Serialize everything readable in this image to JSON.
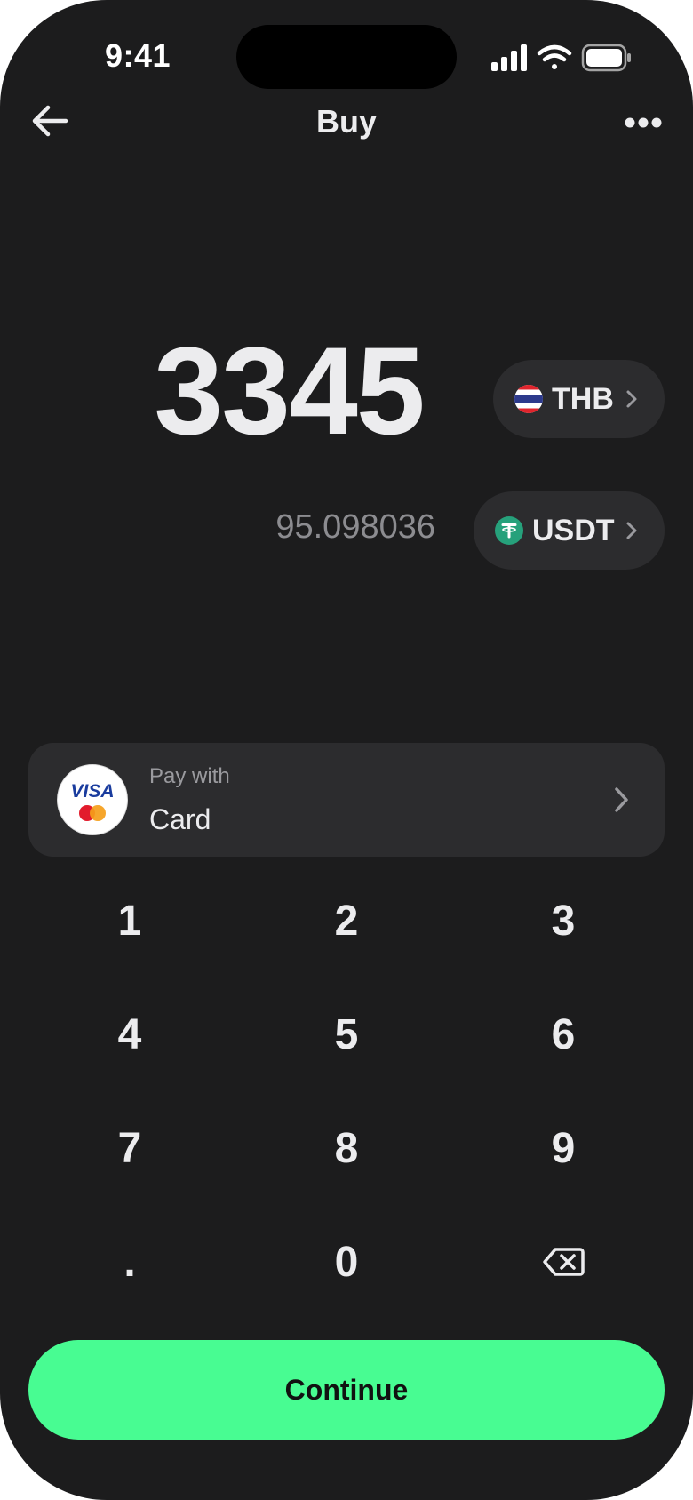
{
  "status_bar": {
    "time": "9:41"
  },
  "nav": {
    "title": "Buy"
  },
  "amount": {
    "value": "3345",
    "converted": "95.098036"
  },
  "currencies": {
    "fiat": {
      "code": "THB",
      "icon": "thailand-flag-icon"
    },
    "crypto": {
      "code": "USDT",
      "icon": "tether-icon",
      "icon_color": "#26a17b"
    }
  },
  "payment": {
    "caption": "Pay with",
    "method": "Card",
    "logo_text": "VISA"
  },
  "keypad": {
    "keys": [
      "1",
      "2",
      "3",
      "4",
      "5",
      "6",
      "7",
      "8",
      "9",
      ".",
      "0"
    ],
    "delete_icon": "backspace-icon"
  },
  "actions": {
    "continue_label": "Continue"
  },
  "colors": {
    "background": "#1c1c1d",
    "surface": "#2c2c2e",
    "accent": "#48fc92"
  }
}
